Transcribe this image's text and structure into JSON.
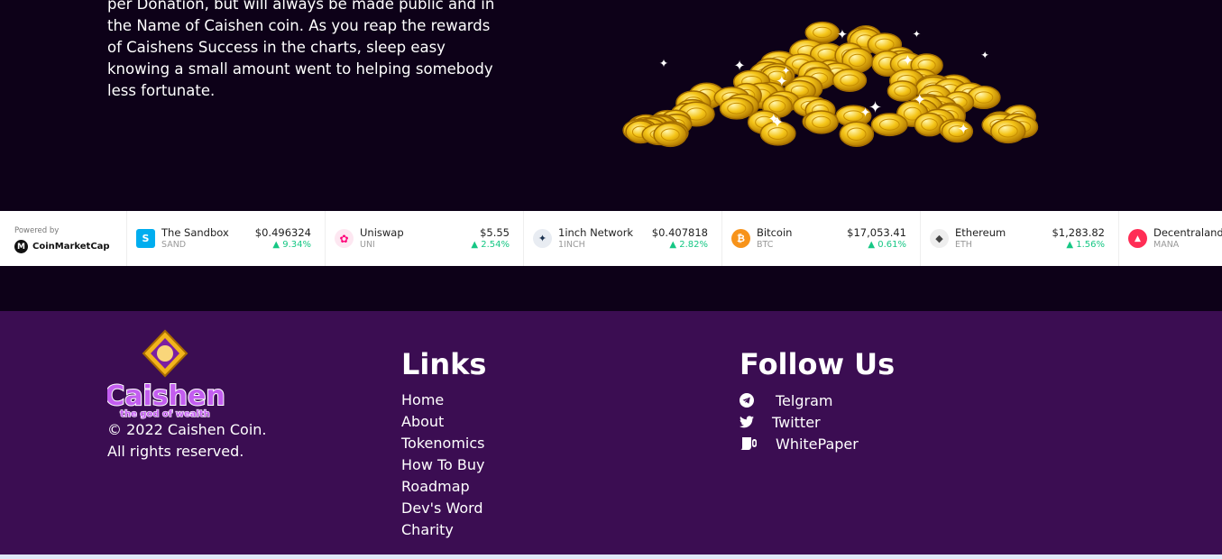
{
  "hero": {
    "text": "per Donation, but will always be made public and in the Name of Caishen coin. As you reap the rewards of Caishens Success in the charts, sleep easy knowing a small amount went to helping somebody less fortunate."
  },
  "ticker": {
    "powered_by": "Powered by",
    "provider": "CoinMarketCap",
    "items": [
      {
        "name": "The Sandbox",
        "symbol": "SAND",
        "price": "$0.496324",
        "change": "9.34%",
        "icon_color": "#00adef",
        "icon_glyph": "S"
      },
      {
        "name": "Uniswap",
        "symbol": "UNI",
        "price": "$5.55",
        "change": "2.54%",
        "icon_color": "#ff007a",
        "icon_glyph": "🦄"
      },
      {
        "name": "1inch Network",
        "symbol": "1INCH",
        "price": "$0.407818",
        "change": "2.82%",
        "icon_color": "#1b314f",
        "icon_glyph": "1"
      },
      {
        "name": "Bitcoin",
        "symbol": "BTC",
        "price": "$17,053.41",
        "change": "0.61%",
        "icon_color": "#f7931a",
        "icon_glyph": "₿"
      },
      {
        "name": "Ethereum",
        "symbol": "ETH",
        "price": "$1,283.82",
        "change": "1.56%",
        "icon_color": "#eeeeee",
        "icon_glyph": "◆"
      },
      {
        "name": "Decentraland",
        "symbol": "MANA",
        "price": "",
        "change": "",
        "icon_color": "#ff2d55",
        "icon_glyph": "▲"
      }
    ]
  },
  "footer": {
    "brand_name": "Caishen",
    "brand_tagline": "the god of wealth",
    "copyright_line1": "© 2022 Caishen Coin.",
    "copyright_line2": "All rights reserved.",
    "links_title": "Links",
    "links": [
      "Home",
      "About",
      "Tokenomics",
      "How To Buy",
      "Roadmap",
      "Dev's Word",
      "Charity"
    ],
    "follow_title": "Follow Us",
    "follow": [
      {
        "label": "Telgram",
        "icon": "telegram-icon"
      },
      {
        "label": "Twitter",
        "icon": "twitter-icon"
      },
      {
        "label": "WhitePaper",
        "icon": "whitepaper-icon"
      }
    ]
  },
  "colors": {
    "page_bg": "#0d0118",
    "footer_bg": "#3b0d52",
    "positive_change": "#16c784",
    "brand_purple": "#8e2fc9"
  }
}
